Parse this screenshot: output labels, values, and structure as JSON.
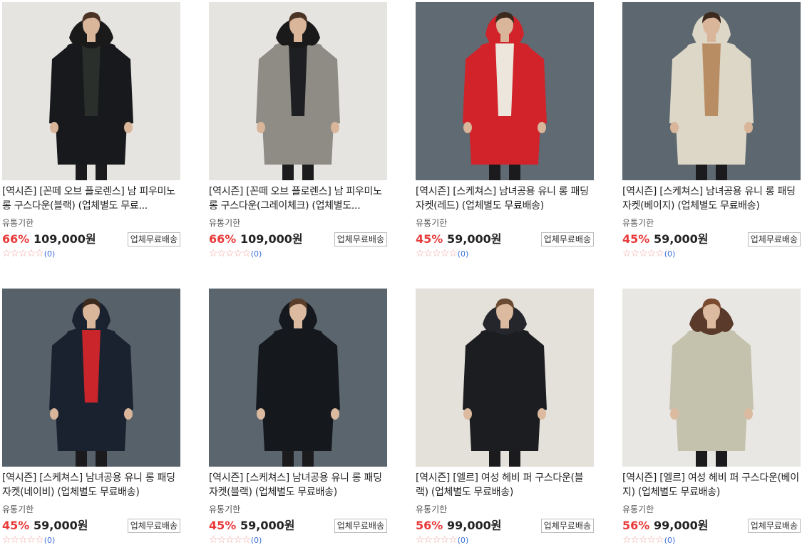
{
  "products": [
    {
      "title": "[역시즌] [꼰떼 오브 플로렌스] 남 피우미노 롱 구스다운(블랙) (업체별도 무료...",
      "expiry_label": "유통기한",
      "discount": "66%",
      "price": "109,000원",
      "ship_badge": "업체무료배송",
      "stars": "☆☆☆☆☆",
      "review_count": "(0)",
      "image": {
        "bg": "#e6e4e1",
        "coat": "#17191c",
        "inner": "#2a2f2b",
        "fur": true,
        "fur_color": "#1a1a1a",
        "skin": "#d9b59a",
        "hair": "#4a3426"
      }
    },
    {
      "title": "[역시즌] [꼰떼 오브 플로렌스] 남 피우미노 롱 구스다운(그레이체크) (업체별도...",
      "expiry_label": "유통기한",
      "discount": "66%",
      "price": "109,000원",
      "ship_badge": "업체무료배송",
      "stars": "☆☆☆☆☆",
      "review_count": "(0)",
      "image": {
        "bg": "#e6e4e1",
        "coat": "#8f8c86",
        "inner": "#1e1f22",
        "fur": true,
        "fur_color": "#1a1a1a",
        "skin": "#d9b59a",
        "hair": "#4a3426"
      }
    },
    {
      "title": "[역시즌] [스케쳐스] 남녀공용 유니 롱 패딩 자켓(레드) (업체별도 무료배송)",
      "expiry_label": "유통기한",
      "discount": "45%",
      "price": "59,000원",
      "ship_badge": "업체무료배송",
      "stars": "☆☆☆☆☆",
      "review_count": "(0)",
      "image": {
        "bg": "#5f6a72",
        "coat": "#d2232a",
        "inner": "#ece6dc",
        "fur": false,
        "fur_color": "#d2232a",
        "skin": "#d9b59a",
        "hair": "#3d2a1e"
      }
    },
    {
      "title": "[역시즌] [스케쳐스] 남녀공용 유니 롱 패딩 자켓(베이지) (업체별도 무료배송)",
      "expiry_label": "유통기한",
      "discount": "45%",
      "price": "59,000원",
      "ship_badge": "업체무료배송",
      "stars": "☆☆☆☆☆",
      "review_count": "(0)",
      "image": {
        "bg": "#5c676f",
        "coat": "#ddd7c8",
        "inner": "#b98d63",
        "fur": false,
        "fur_color": "#ddd7c8",
        "skin": "#d9b59a",
        "hair": "#3d2a1e"
      }
    },
    {
      "title": "[역시즌] [스케쳐스] 남녀공용 유니 롱 패딩 자켓(네이비) (업체별도 무료배송)",
      "expiry_label": "유통기한",
      "discount": "45%",
      "price": "59,000원",
      "ship_badge": "업체무료배송",
      "stars": "☆☆☆☆☆",
      "review_count": "(0)",
      "image": {
        "bg": "#56616a",
        "coat": "#1a2230",
        "inner": "#c9252b",
        "fur": false,
        "fur_color": "#1a2230",
        "skin": "#d9b59a",
        "hair": "#3d2a1e"
      }
    },
    {
      "title": "[역시즌] [스케쳐스] 남녀공용 유니 롱 패딩 자켓(블랙) (업체별도 무료배송)",
      "expiry_label": "유통기한",
      "discount": "45%",
      "price": "59,000원",
      "ship_badge": "업체무료배송",
      "stars": "☆☆☆☆☆",
      "review_count": "(0)",
      "image": {
        "bg": "#5a656d",
        "coat": "#15181d",
        "inner": "#15181d",
        "fur": false,
        "fur_color": "#15181d",
        "skin": "#dcbaa0",
        "hair": "#5a3e2a"
      }
    },
    {
      "title": "[역시즌] [엘르] 여성 헤비 퍼 구스다운(블랙) (업체별도 무료배송)",
      "expiry_label": "유통기한",
      "discount": "56%",
      "price": "99,000원",
      "ship_badge": "업체무료배송",
      "stars": "☆☆☆☆☆",
      "review_count": "(0)",
      "image": {
        "bg": "#e4e0da",
        "coat": "#1c1d20",
        "inner": "#1c1d20",
        "fur": true,
        "fur_color": "#24262c",
        "skin": "#dcbaa0",
        "hair": "#6a4a32"
      }
    },
    {
      "title": "[역시즌] [엘르] 여성 헤비 퍼 구스다운(베이지) (업체별도 무료배송)",
      "expiry_label": "유통기한",
      "discount": "56%",
      "price": "99,000원",
      "ship_badge": "업체무료배송",
      "stars": "☆☆☆☆☆",
      "review_count": "(0)",
      "image": {
        "bg": "#e9e7e3",
        "coat": "#c4c2ad",
        "inner": "#c4c2ad",
        "fur": true,
        "fur_color": "#5a3a2a",
        "skin": "#dcbaa0",
        "hair": "#7a4a2e"
      }
    }
  ]
}
